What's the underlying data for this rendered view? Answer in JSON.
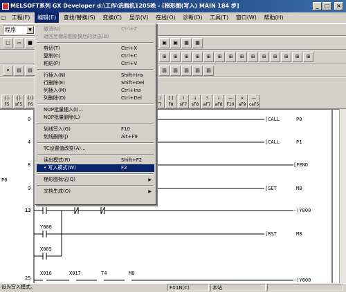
{
  "title": "MELSOFT系列 GX Developer d:\\工作\\洗瓶机1205晚 - [梯形图(写入)    MAIN    184 步]",
  "menubar": [
    "工程(F)",
    "编辑(E)",
    "查找/替换(S)",
    "变换(C)",
    "显示(V)",
    "在线(O)",
    "诊断(D)",
    "工具(T)",
    "窗口(W)",
    "帮助(H)"
  ],
  "program_combo": "程序",
  "fkeys": [
    "F5",
    "sF5",
    "F6",
    "sF6",
    "F7",
    "F8",
    "F9",
    "sF9",
    "cF9",
    "cF10",
    "sF7",
    "sF8",
    "aF7",
    "aF8",
    "aF5",
    "caF5",
    "caF10",
    "F10",
    "aF9"
  ],
  "edit_menu": [
    {
      "label": "撤消(U)",
      "shortcut": "Ctrl+Z",
      "state": "disabled"
    },
    {
      "label": "返回至梯形图变换后的状态(B)",
      "shortcut": "",
      "state": "disabled"
    },
    {
      "sep": true
    },
    {
      "label": "剪切(T)",
      "shortcut": "Ctrl+X",
      "state": "normal"
    },
    {
      "label": "复制(C)",
      "shortcut": "Ctrl+C",
      "state": "normal"
    },
    {
      "label": "粘贴(P)",
      "shortcut": "Ctrl+V",
      "state": "normal"
    },
    {
      "sep": true
    },
    {
      "label": "行插入(N)",
      "shortcut": "Shift+Ins",
      "state": "normal"
    },
    {
      "label": "行删除(E)",
      "shortcut": "Shift+Del",
      "state": "normal"
    },
    {
      "label": "列插入(M)",
      "shortcut": "Ctrl+Ins",
      "state": "normal"
    },
    {
      "label": "列删除(D)",
      "shortcut": "Ctrl+Del",
      "state": "normal"
    },
    {
      "sep": true
    },
    {
      "label": "NOP批量插入(I)...",
      "shortcut": "",
      "state": "normal"
    },
    {
      "label": "NOP批量删除(L)",
      "shortcut": "",
      "state": "normal"
    },
    {
      "sep": true
    },
    {
      "label": "划线写入(G)",
      "shortcut": "F10",
      "state": "normal"
    },
    {
      "label": "划线删除(J)",
      "shortcut": "Alt+F9",
      "state": "normal"
    },
    {
      "sep": true
    },
    {
      "label": "TC设置值改变(A)...",
      "shortcut": "",
      "state": "normal"
    },
    {
      "sep": true
    },
    {
      "label": "读出模式(R)",
      "shortcut": "Shift+F2",
      "state": "normal"
    },
    {
      "label": "• 写入模式(W)",
      "shortcut": "F2",
      "state": "selected"
    },
    {
      "sep": true
    },
    {
      "label": "梯形图标记(Q)",
      "shortcut": "",
      "state": "submenu"
    },
    {
      "sep": true
    },
    {
      "label": "文档生成(O)",
      "shortcut": "",
      "state": "submenu"
    }
  ],
  "ladder": {
    "step_numbers": [
      "0",
      "4",
      "8",
      "9",
      "13",
      "25"
    ],
    "left_label": "P0",
    "instructions": [
      {
        "op": "[CALL",
        "arg": "P0"
      },
      {
        "op": "[CALL",
        "arg": "P1"
      },
      {
        "op": "[FEND",
        "arg": ""
      },
      {
        "op": "[SET",
        "arg": "M8"
      },
      {
        "op": "-(Y000",
        "arg": ""
      },
      {
        "op": "[RST",
        "arg": "M8"
      },
      {
        "op": "-(Y000",
        "arg": ""
      }
    ],
    "contacts_row13": [
      "Y000",
      "X005"
    ],
    "contacts_row25": [
      "X016",
      "X017",
      "T4",
      "M8"
    ]
  },
  "status": {
    "message": "设为写入模式。",
    "plc": "FX1N(C)",
    "station": "本站"
  }
}
